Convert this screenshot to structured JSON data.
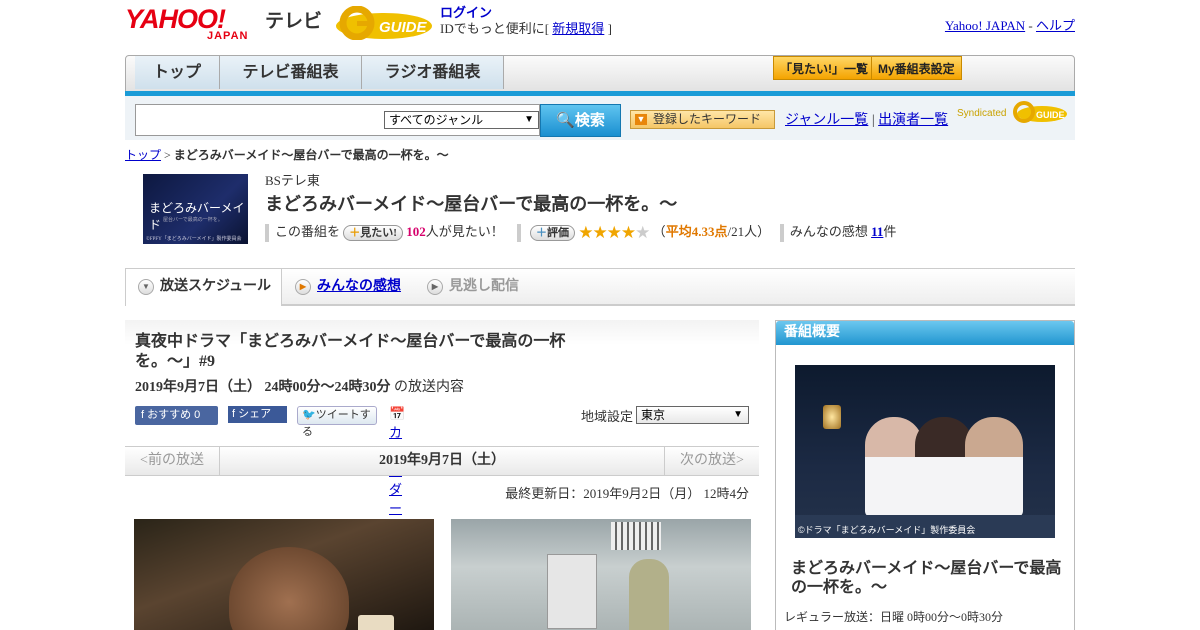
{
  "header": {
    "yahoo_logo": "YAHOO!",
    "yahoo_sub": "JAPAN",
    "tv_label": "テレビ",
    "gguide_logo": "G GUIDE",
    "login_label": "ログイン",
    "login_desc": "IDでもっと便利に[",
    "register_label": "新規取得",
    "login_close": "]",
    "link_yahoo": "Yahoo! JAPAN",
    "link_sep": "-",
    "link_help": "ヘルプ"
  },
  "nav": {
    "tabs": [
      {
        "label": "トップ"
      },
      {
        "label": "テレビ番組表"
      },
      {
        "label": "ラジオ番組表"
      }
    ],
    "want_list": "「見たい!」一覧",
    "my_schedule": "My番組表設定"
  },
  "search": {
    "input_value": "",
    "genre": "すべてのジャンル",
    "button": "検索",
    "keyword_button": "登録したキーワード",
    "genre_list": "ジャンル一覧",
    "divider": "|",
    "cast_list": "出演者一覧",
    "syndicated": "Syndicated"
  },
  "breadcrumb": {
    "home": "トップ",
    "sep": ">",
    "current": "まどろみバーメイド～屋台バーで最高の一杯を。～"
  },
  "program": {
    "thumb_title": "まどろみバーメイド",
    "thumb_sub": "屋台バーで最高の一杯を。",
    "thumb_copy": "©FPFY「まどろみバーメイド」製作委員会",
    "channel": "BSテレ東",
    "title": "まどろみバーメイド～屋台バーで最高の一杯を。～",
    "want_prefix": "この番組を",
    "want_button": "見たい!",
    "want_count": "102",
    "want_suffix": "人が見たい！",
    "rating_button": "評価",
    "rating_value": 4.33,
    "rating_stars_on": "★★★★",
    "rating_stars_off": "★",
    "rating_open": "（",
    "rating_avg": "平均4.33点",
    "rating_count": "/21人）",
    "review_prefix": "みんなの感想",
    "review_count": "11",
    "review_suffix": "件"
  },
  "tabs": {
    "schedule": "放送スケジュール",
    "reviews": "みんなの感想",
    "streaming": "見逃し配信"
  },
  "episode": {
    "title": "真夜中ドラマ「まどろみバーメイド～屋台バーで最高の一杯を。～」#9",
    "date": "2019年9月7日（土）  24時00分～24時30分",
    "date_suffix": " の放送内容",
    "fb_recommend": "おすすめ 0",
    "fb_share": "シェア",
    "tweet": "ツイートする",
    "calendar": "カレンダーに登録",
    "region_label": "地域設定",
    "region_value": "東京",
    "prev": "<前の放送",
    "current_date": "2019年9月7日（土）",
    "next": "次の放送>",
    "updated": "最終更新日：2019年9月2日（月） 12時4分"
  },
  "side": {
    "heading": "番組概要",
    "image_caption": "©ドラマ「まどろみバーメイド」製作委員会",
    "title": "まどろみバーメイド～屋台バーで最高の一杯を。～",
    "regular": "レギュラー放送：日曜 0時00分～0時30分"
  }
}
